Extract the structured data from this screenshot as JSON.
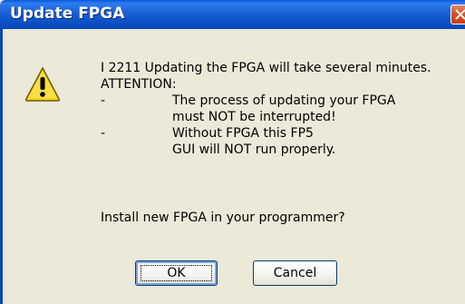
{
  "window": {
    "title": "Update FPGA",
    "close_icon": "close-icon"
  },
  "message": {
    "icon": "warning-icon",
    "line1": "I 2211 Updating the FPGA will take several minutes.",
    "line2": "ATTENTION:",
    "bullet1_dash": "-",
    "bullet1_line1": "The process of updating your FPGA",
    "bullet1_line2": "must NOT be interrupted!",
    "bullet2_dash": "-",
    "bullet2_line1": "Without FPGA this FP5",
    "bullet2_line2": "GUI will NOT run properly.",
    "prompt": "Install new FPGA in your programmer?"
  },
  "buttons": {
    "ok_label": "OK",
    "cancel_label": "Cancel"
  },
  "colors": {
    "titlebar": "#0b4fc4",
    "dialog_bg": "#ece9d8",
    "close_button": "#d9512a"
  }
}
